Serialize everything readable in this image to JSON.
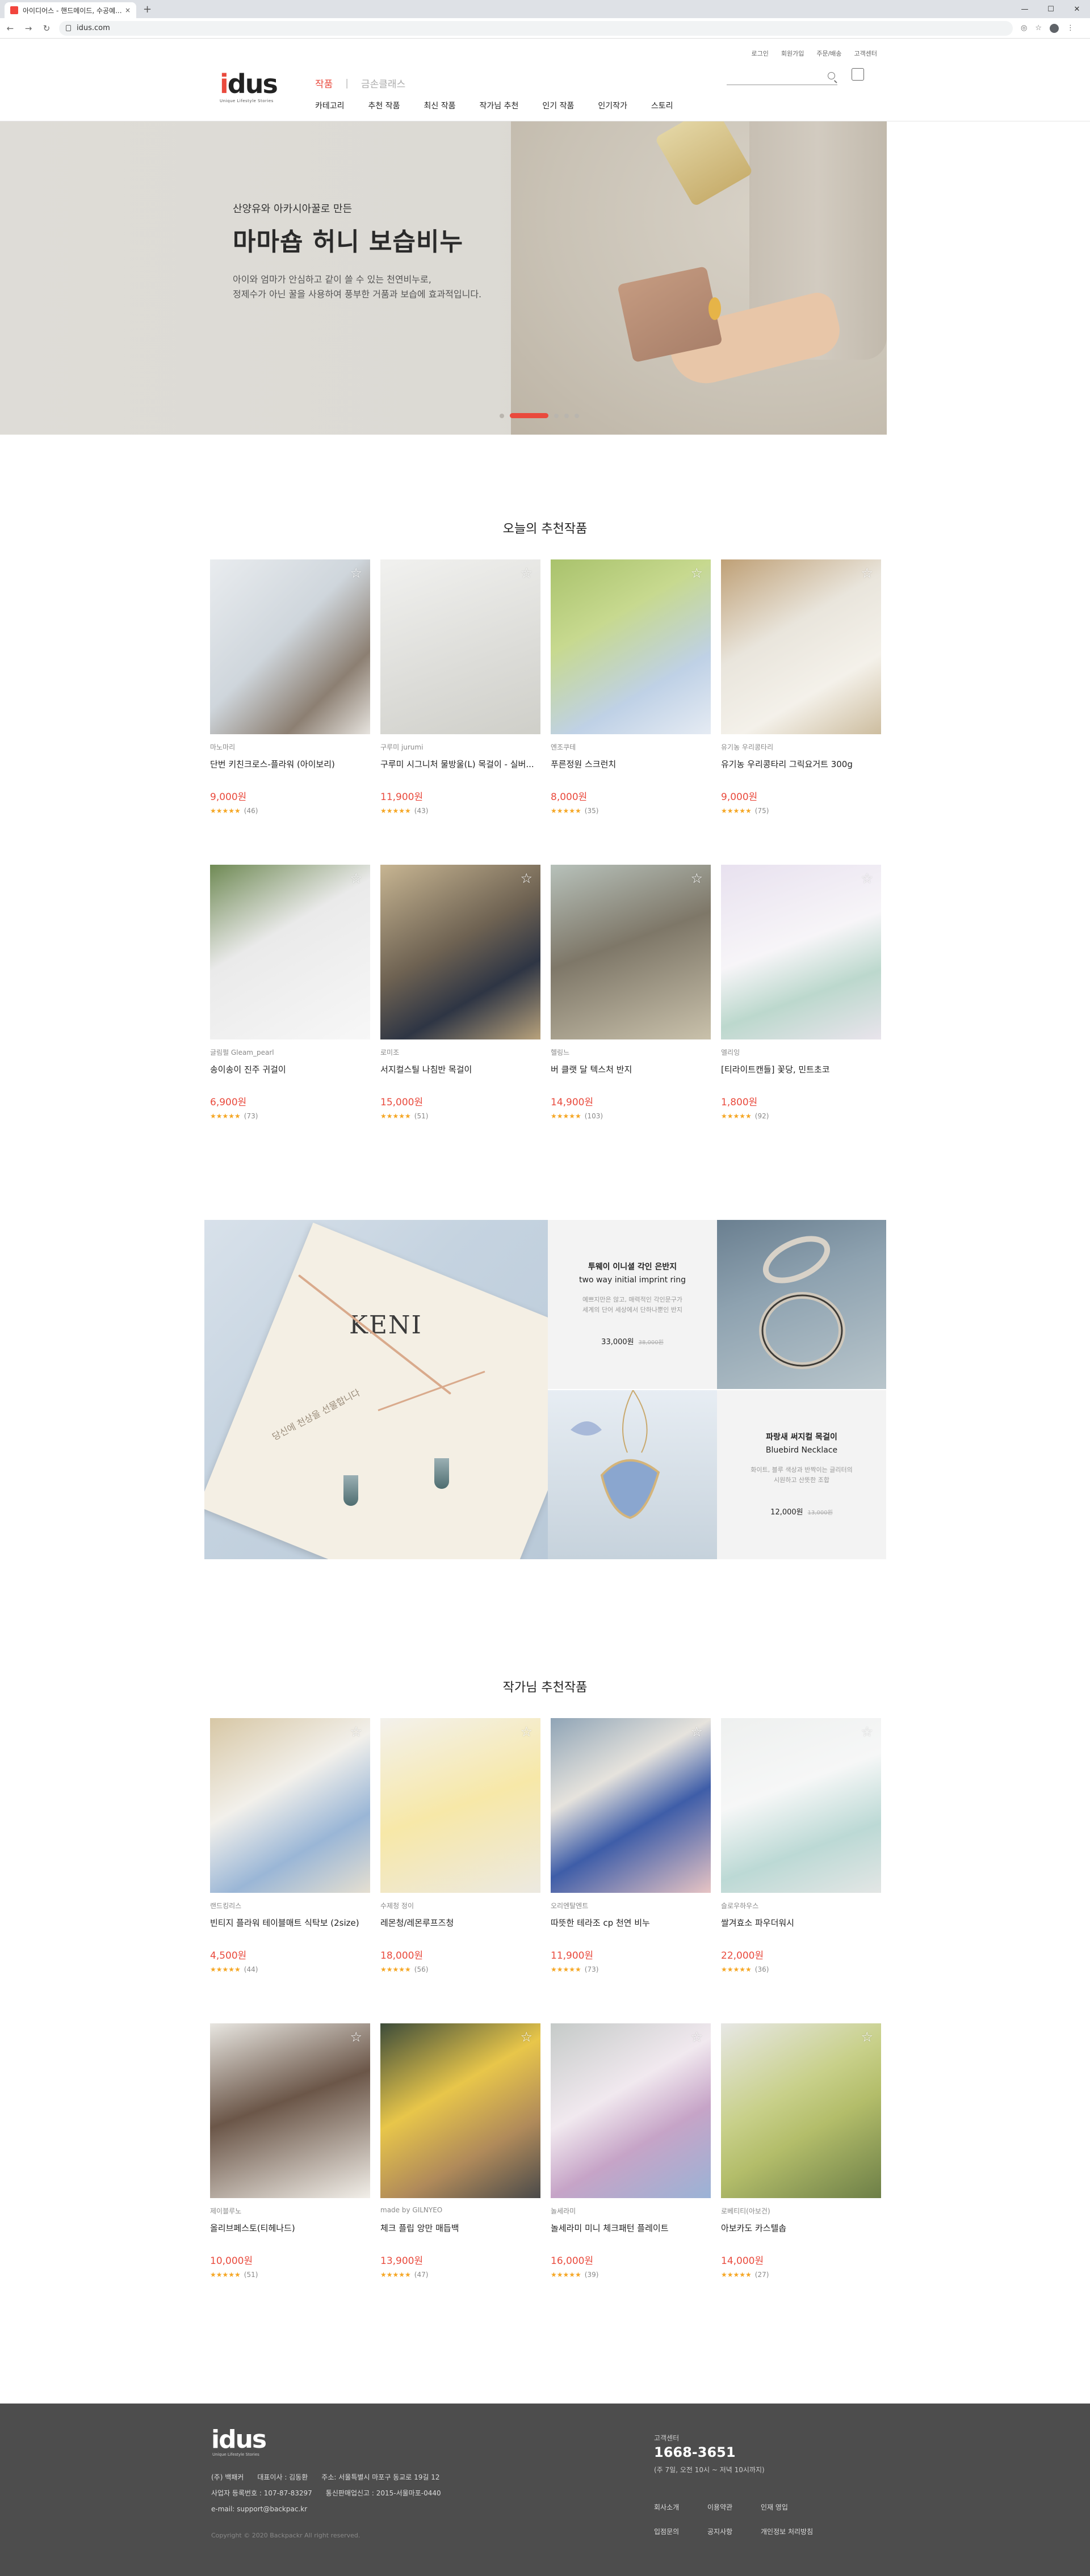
{
  "browser": {
    "tab_title": "아이디어스 - 핸드메이드, 수공예...",
    "tab_close": "×",
    "new_tab": "+",
    "url": "idus.com",
    "win_min": "—",
    "win_max": "☐",
    "win_close": "✕"
  },
  "header": {
    "util_links": [
      "로그인",
      "회원가입",
      "주문/배송",
      "고객센터"
    ],
    "logo_text_i": "i",
    "logo_text_rest": "dus",
    "logo_sub": "Unique Lifestyle Stories",
    "tab_active": "작품",
    "tab_sep": "|",
    "tab_inactive": "금손클래스",
    "nav": [
      "카테고리",
      "추천 작품",
      "최신 작품",
      "작가님 추천",
      "인기 작품",
      "인기작가",
      "스토리"
    ]
  },
  "hero": {
    "subtitle": "산양유와 아카시아꿀로 만든",
    "title": "마마숍 허니 보습비누",
    "desc": "아이와 엄마가 안심하고 같이 쓸 수 있는 천연비누로,\n정제수가 아닌 꿀을 사용하여 풍부한 거품과 보습에 효과적입니다.",
    "slides": 5,
    "active_slide": 2
  },
  "today": {
    "title": "오늘의 추천작품",
    "items": [
      {
        "shop": "마노마리",
        "name": "단번 키친크로스-플라워 (아이보리)",
        "price": "9,000원",
        "stars": "★★★★★",
        "count": "(46)"
      },
      {
        "shop": "구루미 jurumi",
        "name": "구루미 시그니처 물방울(L) 목걸이 - 실버...",
        "price": "11,900원",
        "stars": "★★★★★",
        "count": "(43)"
      },
      {
        "shop": "엔조쿠테",
        "name": "푸른정원 스크런치",
        "price": "8,000원",
        "stars": "★★★★★",
        "count": "(35)"
      },
      {
        "shop": "유기농 우리콩타리",
        "name": "유기농 우리콩타리 그릭요거트 300g",
        "price": "9,000원",
        "stars": "★★★★★",
        "count": "(75)"
      },
      {
        "shop": "글림펄 Gleam_pearl",
        "name": "송이송이 진주 귀걸이",
        "price": "6,900원",
        "stars": "★★★★★",
        "count": "(73)"
      },
      {
        "shop": "로미조",
        "name": "서지컬스틸 나침반 목걸이",
        "price": "15,000원",
        "stars": "★★★★★",
        "count": "(51)"
      },
      {
        "shop": "헬링느",
        "name": "버 클랫 달 텍스처 반지",
        "price": "14,900원",
        "stars": "★★★★★",
        "count": "(103)"
      },
      {
        "shop": "엘리잉",
        "name": "[티라이트캔들] 꽃당, 민트초코",
        "price": "1,800원",
        "stars": "★★★★★",
        "count": "(92)"
      }
    ]
  },
  "promo": {
    "big_text": "KENI",
    "big_caption": "당신에 천상을 선물합니다",
    "ring": {
      "title_ko": "투웨이 이니셜 각인 은반지",
      "title_en": "two way initial imprint ring",
      "desc": "예쁘지만은 않고, 매력적인 각인문구가\n세계의 단어 세상에서 단하나뿐인 반지",
      "price": "33,000원",
      "old": "38,000원"
    },
    "necklace": {
      "title_ko": "파랑새 써지컬 목걸이",
      "title_en": "Bluebird Necklace",
      "desc": "화이트, 블루 색상과 반짝이는 글리터의\n시원하고 산뜻한 조합",
      "price": "12,000원",
      "old": "13,000원"
    }
  },
  "artist": {
    "title": "작가님 추천작품",
    "items": [
      {
        "shop": "랜드킹리스",
        "name": "빈티지 플라워 테이블매트 식탁보 (2size)",
        "price": "4,500원",
        "stars": "★★★★★",
        "count": "(44)"
      },
      {
        "shop": "수제청 정이",
        "name": "레몬청/레몬루프즈청",
        "price": "18,000원",
        "stars": "★★★★★",
        "count": "(56)"
      },
      {
        "shop": "오리엔탈엔트",
        "name": "따뜻한 테라조 cp 천연 비누",
        "price": "11,900원",
        "stars": "★★★★★",
        "count": "(73)"
      },
      {
        "shop": "슬로우하우스",
        "name": "쌀겨효소 파우더워시",
        "price": "22,000원",
        "stars": "★★★★★",
        "count": "(36)"
      },
      {
        "shop": "제이블루노",
        "name": "올리브페스토(티헤나드)",
        "price": "10,000원",
        "stars": "★★★★★",
        "count": "(51)"
      },
      {
        "shop": "made by GILNYEO",
        "name": "체크 플립 앙만 매듭백",
        "price": "13,900원",
        "stars": "★★★★★",
        "count": "(47)"
      },
      {
        "shop": "놀세라미",
        "name": "놀세라미 미니 체크패턴 플레이트",
        "price": "16,000원",
        "stars": "★★★★★",
        "count": "(39)"
      },
      {
        "shop": "로베티티(아보건)",
        "name": "아보카도 카스텔솝",
        "price": "14,000원",
        "stars": "★★★★★",
        "count": "(27)"
      }
    ]
  },
  "footer": {
    "logo": "idus",
    "logo_sub": "Unique Lifestyle Stories",
    "company": "(주) 백패커",
    "ceo": "대표이사 : 김동환",
    "address": "주소: 서울특별시 마포구 동교로 19길 12",
    "bizno": "사업자 등록번호 : 107-87-83297",
    "mailorder": "통신판매업신고 : 2015-서울마포-0440",
    "email": "e-mail: support@backpac.kr",
    "copyright": "Copyright © 2020 Backpackr All right reserved.",
    "cs_label": "고객센터",
    "cs_phone": "1668-3651",
    "cs_hours": "(주 7일, 오전 10시 ~ 저녁 10시까지)",
    "links": [
      "회사소개",
      "이용약관",
      "인재 영입",
      "입점문의",
      "공지사항",
      "개인정보 처리방침"
    ]
  }
}
